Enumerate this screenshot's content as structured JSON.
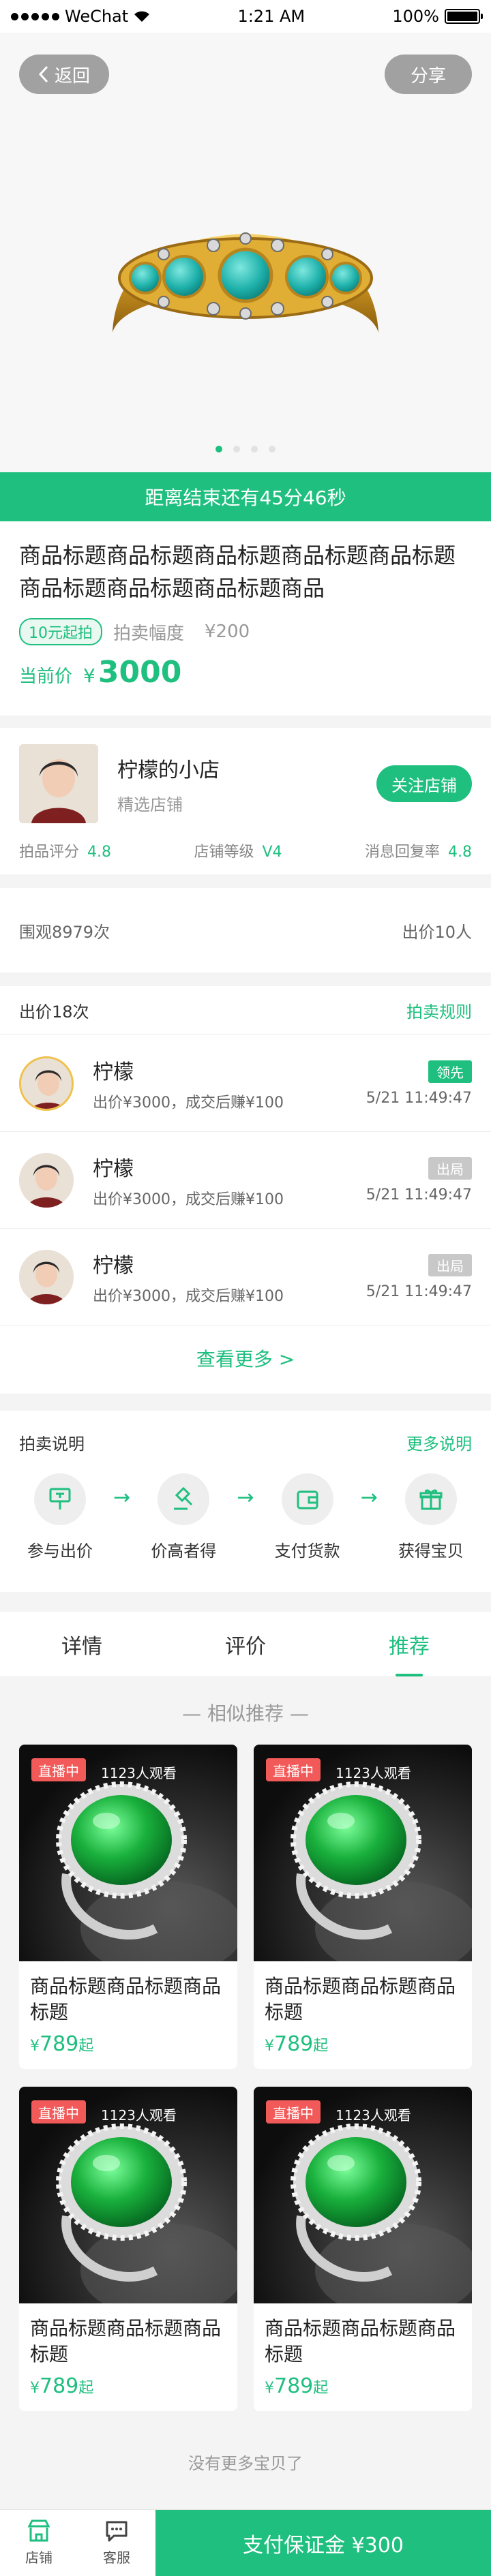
{
  "status_bar": {
    "carrier": "WeChat",
    "time": "1:21 AM",
    "battery": "100%",
    "battery_level": 1.0
  },
  "hero": {
    "back_label": "返回",
    "share_label": "分享",
    "slide_count": 4,
    "active_slide": 1
  },
  "countdown": {
    "text": "距离结束还有45分46秒"
  },
  "product": {
    "title": "商品标题商品标题商品标题商品标题商品标题商品标题商品标题商品标题商品",
    "start_badge": "10元起拍",
    "step_label": "拍卖幅度",
    "step_value": "¥200",
    "current_label": "当前价",
    "currency": "¥",
    "current_price": "3000"
  },
  "shop": {
    "name": "柠檬的小店",
    "tag": "精选店铺",
    "follow_label": "关注店铺",
    "stats": [
      {
        "label": "拍品评分",
        "value": "4.8"
      },
      {
        "label": "店铺等级",
        "value": "V4"
      },
      {
        "label": "消息回复率",
        "value": "4.8"
      }
    ]
  },
  "views": {
    "views_text": "围观8979次",
    "bids_text": "出价10人"
  },
  "bids": {
    "title": "出价18次",
    "rules_link": "拍卖规则",
    "rows": [
      {
        "name": "柠檬",
        "desc": "出价¥3000，成交后赚¥100",
        "badge": "领先",
        "time": "5/21 11:49:47"
      },
      {
        "name": "柠檬",
        "desc": "出价¥3000，成交后赚¥100",
        "badge": "出局",
        "time": "5/21 11:49:47"
      },
      {
        "name": "柠檬",
        "desc": "出价¥3000，成交后赚¥100",
        "badge": "出局",
        "time": "5/21 11:49:47"
      }
    ],
    "see_more": "查看更多 >"
  },
  "rules": {
    "title": "拍卖说明",
    "more_link": "更多说明",
    "steps": [
      {
        "label": "参与出价",
        "icon": "bid-sign-icon"
      },
      {
        "label": "价高者得",
        "icon": "gavel-icon"
      },
      {
        "label": "支付货款",
        "icon": "wallet-icon"
      },
      {
        "label": "获得宝贝",
        "icon": "gift-icon"
      }
    ]
  },
  "tabs": {
    "items": [
      "详情",
      "评价",
      "推荐"
    ],
    "active": 2
  },
  "recommend": {
    "section_title": "— 相似推荐 —",
    "items": [
      {
        "live": "直播中",
        "viewers": "1123人观看",
        "title": "商品标题商品标题商品标题",
        "currency": "¥",
        "price": "789",
        "suffix": "起"
      },
      {
        "live": "直播中",
        "viewers": "1123人观看",
        "title": "商品标题商品标题商品标题",
        "currency": "¥",
        "price": "789",
        "suffix": "起"
      },
      {
        "live": "直播中",
        "viewers": "1123人观看",
        "title": "商品标题商品标题商品标题",
        "currency": "¥",
        "price": "789",
        "suffix": "起"
      },
      {
        "live": "直播中",
        "viewers": "1123人观看",
        "title": "商品标题商品标题商品标题",
        "currency": "¥",
        "price": "789",
        "suffix": "起"
      }
    ],
    "no_more": "没有更多宝贝了"
  },
  "bottom_bar": {
    "shop_label": "店铺",
    "service_label": "客服",
    "pay_label": "支付保证金 ¥300"
  },
  "colors": {
    "accent": "#1fbf7f",
    "live_red": "#f25a5a",
    "leader_gold": "#f0c14b"
  }
}
